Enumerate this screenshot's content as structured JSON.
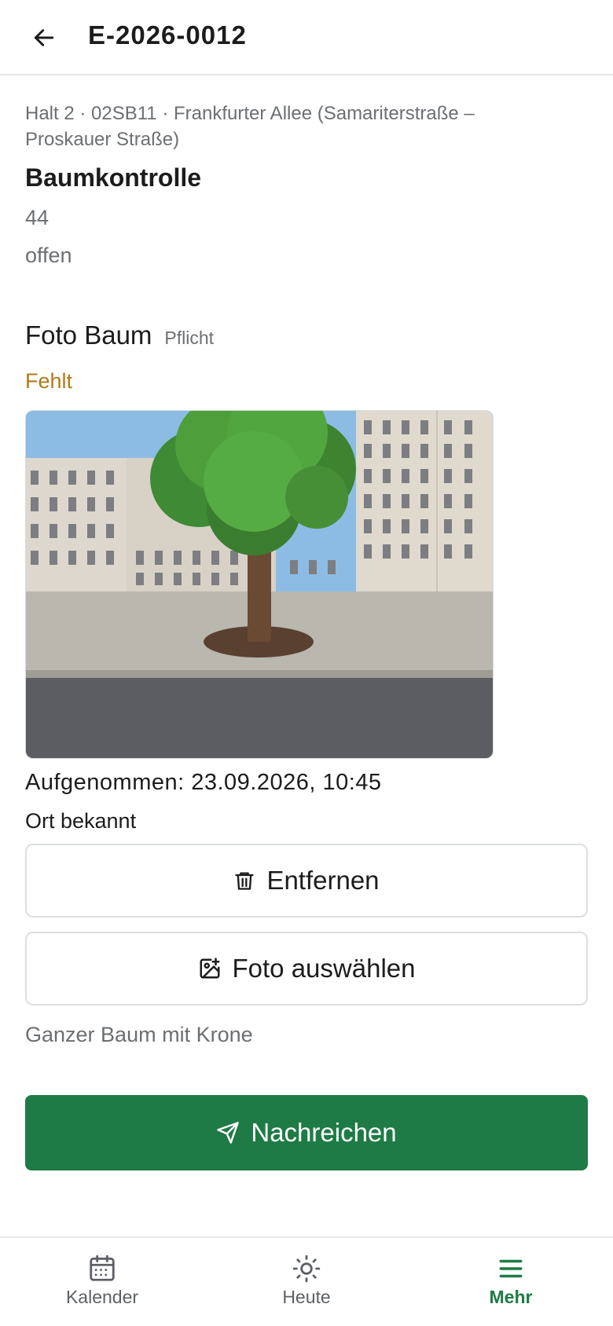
{
  "header": {
    "title": "E-2026-0012",
    "back_icon": "arrow-left-icon"
  },
  "task": {
    "breadcrumb": "Halt 2 · 02SB11 · Frankfurter Allee (Samariterstraße – Proskauer Straße)",
    "title": "Baumkontrolle",
    "number": "44",
    "status": "offen"
  },
  "photo_section": {
    "title": "Foto Baum",
    "required_label": "Pflicht",
    "status": "Fehlt",
    "taken": "Aufgenommen: 23.09.2026, 10:45",
    "location": "Ort bekannt",
    "remove_label": "Entfernen",
    "select_label": "Foto auswählen",
    "hint": "Ganzer Baum mit Krone"
  },
  "submit": {
    "label": "Nachreichen"
  },
  "nav": {
    "items": [
      {
        "label": "Kalender",
        "icon": "calendar-icon"
      },
      {
        "label": "Heute",
        "icon": "sun-icon"
      },
      {
        "label": "Mehr",
        "icon": "menu-icon",
        "active": true
      }
    ]
  },
  "colors": {
    "accent": "#1e7b45",
    "warning": "#b07a18",
    "muted": "#6b6f73"
  }
}
